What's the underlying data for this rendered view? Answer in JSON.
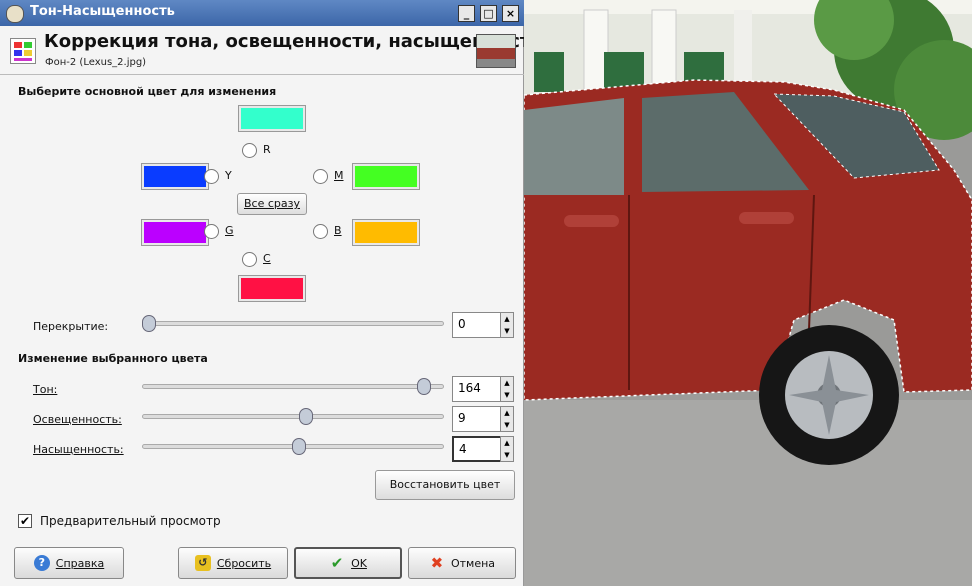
{
  "window": {
    "title": "Тон-Насыщенность",
    "btn_min": "_",
    "btn_max": "□",
    "btn_close": "×"
  },
  "header": {
    "title": "Коррекция тона, освещенности, насыщенности",
    "subtitle": "Фон-2 (Lexus_2.jpg)"
  },
  "primary_color": {
    "heading": "Выберите основной цвет для изменения",
    "options": [
      {
        "key": "R",
        "label": "R",
        "color": "#33ffcc"
      },
      {
        "key": "Y",
        "label": "Y",
        "color": "#0a3cff"
      },
      {
        "key": "M",
        "label": "M",
        "color": "#44ff22"
      },
      {
        "key": "G",
        "label": "G",
        "color": "#bb00ff"
      },
      {
        "key": "B",
        "label": "B",
        "color": "#ffbb00"
      },
      {
        "key": "C",
        "label": "C",
        "color": "#ff1144"
      }
    ],
    "all_button": "Все сразу"
  },
  "overlap": {
    "label": "Перекрытие:",
    "value": "0",
    "fraction": 0.0
  },
  "adjust": {
    "heading": "Изменение выбранного цвета",
    "hue": {
      "label": "Тон:",
      "value": "164",
      "fraction": 0.955
    },
    "lightness": {
      "label": "Освещенность:",
      "value": "9",
      "fraction": 0.545
    },
    "saturation": {
      "label": "Насыщенность:",
      "value": "4",
      "fraction": 0.52
    },
    "reset_color_button": "Восстановить цвет"
  },
  "preview": {
    "label": "Предварительный просмотр",
    "checked": true,
    "check_glyph": "✔"
  },
  "buttons": {
    "help": "Справка",
    "reset": "Сбросить",
    "ok": "OK",
    "cancel": "Отмена"
  },
  "icons": {
    "help": "?",
    "ok": "✔",
    "cancel": "✖",
    "reset": "↺"
  },
  "spin_arrows": {
    "up": "▲",
    "down": "▼"
  }
}
